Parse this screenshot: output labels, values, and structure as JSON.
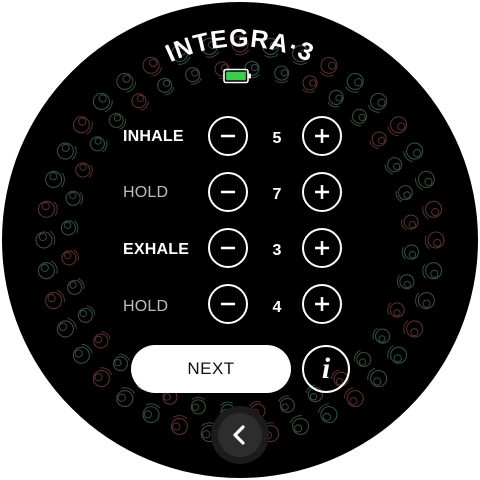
{
  "app": {
    "title": "INTEGRA·3",
    "battery_color": "#3ccf4e"
  },
  "rows": [
    {
      "label": "INHALE",
      "value": "5",
      "emphasis": "strong"
    },
    {
      "label": "HOLD",
      "value": "7",
      "emphasis": "weak"
    },
    {
      "label": "EXHALE",
      "value": "3",
      "emphasis": "strong"
    },
    {
      "label": "HOLD",
      "value": "4",
      "emphasis": "weak"
    }
  ],
  "actions": {
    "next_label": "NEXT",
    "info_label": "i",
    "back_icon": "chevron-left-icon"
  },
  "theme": {
    "background": "#000000",
    "foreground": "#ffffff",
    "pattern_colors": [
      "#5a2f2c",
      "#2f4f44",
      "#3b4b3a"
    ]
  }
}
